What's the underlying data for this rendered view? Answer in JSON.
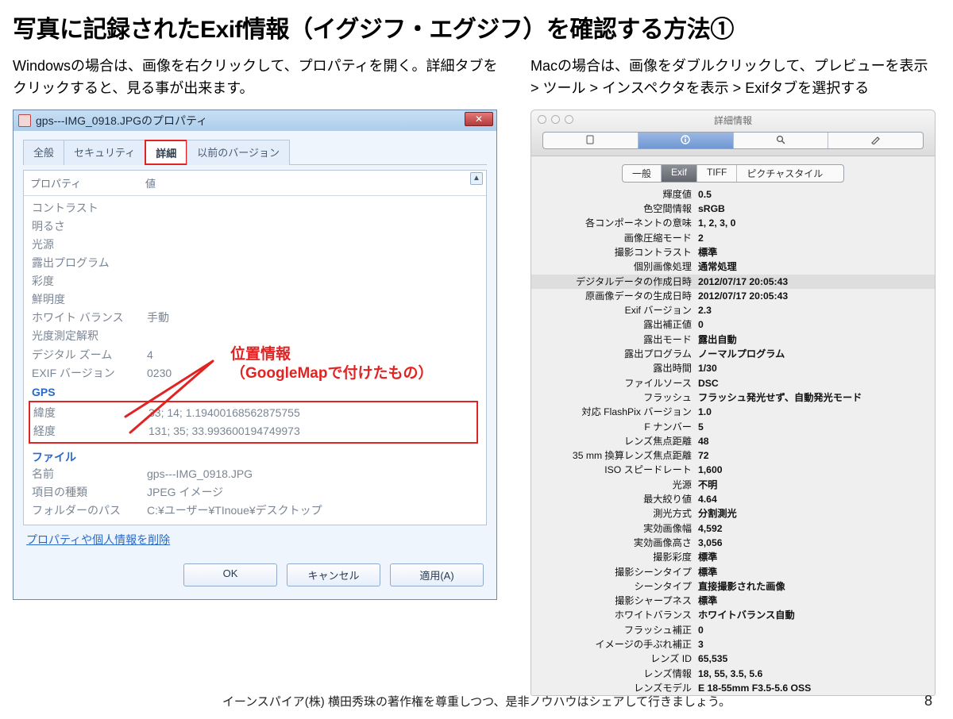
{
  "title": "写真に記録されたExif情報（イグジフ・エグジフ）を確認する方法①",
  "left": {
    "lead": "Windowsの場合は、画像を右クリックして、プロパティを開く。詳細タブをクリックすると、見る事が出来ます。",
    "win": {
      "title": "gps---IMG_0918.JPGのプロパティ",
      "tabs": {
        "t0": "全般",
        "t1": "セキュリティ",
        "t2": "詳細",
        "t3": "以前のバージョン"
      },
      "header": {
        "c1": "プロパティ",
        "c2": "値"
      },
      "rows": {
        "r0k": "コントラスト",
        "r0v": "",
        "r1k": "明るさ",
        "r1v": "",
        "r2k": "光源",
        "r2v": "",
        "r3k": "露出プログラム",
        "r3v": "",
        "r4k": "彩度",
        "r4v": "",
        "r5k": "鮮明度",
        "r5v": "",
        "r6k": "ホワイト バランス",
        "r6v": "手動",
        "r7k": "光度測定解釈",
        "r7v": "",
        "r8k": "デジタル ズーム",
        "r8v": "4",
        "r9k": "EXIF バージョン",
        "r9v": "0230"
      },
      "gps": {
        "head": "GPS",
        "latk": "緯度",
        "latv": "33; 14; 1.19400168562875755",
        "lonk": "経度",
        "lonv": "131; 35; 33.993600194749973"
      },
      "file": {
        "head": "ファイル",
        "namek": "名前",
        "namev": "gps---IMG_0918.JPG",
        "typek": "項目の種類",
        "typev": "JPEG イメージ",
        "pathk": "フォルダーのパス",
        "pathv": "C:¥ユーザー¥TInoue¥デスクトップ"
      },
      "link": "プロパティや個人情報を削除",
      "buttons": {
        "ok": "OK",
        "cancel": "キャンセル",
        "apply": "適用(A)"
      },
      "annotation": {
        "l1": "位置情報",
        "l2": "（GoogleMapで付けたもの）"
      }
    }
  },
  "right": {
    "lead": "Macの場合は、画像をダブルクリックして、プレビューを表示 > ツール > インスペクタを表示 > Exifタブを選択する",
    "mac": {
      "title": "詳細情報",
      "tabs": {
        "t0": "一般",
        "t1": "Exif",
        "t2": "TIFF",
        "t3": "ピクチャスタイル"
      },
      "rows": [
        {
          "k": "輝度値",
          "v": "0.5"
        },
        {
          "k": "色空間情報",
          "v": "sRGB"
        },
        {
          "k": "各コンポーネントの意味",
          "v": "1, 2, 3, 0"
        },
        {
          "k": "画像圧縮モード",
          "v": "2"
        },
        {
          "k": "撮影コントラスト",
          "v": "標準"
        },
        {
          "k": "個別画像処理",
          "v": "通常処理"
        },
        {
          "k": "デジタルデータの作成日時",
          "v": "2012/07/17 20:05:43",
          "hl": true
        },
        {
          "k": "原画像データの生成日時",
          "v": "2012/07/17 20:05:43"
        },
        {
          "k": "Exif バージョン",
          "v": "2.3"
        },
        {
          "k": "露出補正値",
          "v": "0"
        },
        {
          "k": "露出モード",
          "v": "露出自動"
        },
        {
          "k": "露出プログラム",
          "v": "ノーマルプログラム"
        },
        {
          "k": "露出時間",
          "v": "1/30"
        },
        {
          "k": "ファイルソース",
          "v": "DSC"
        },
        {
          "k": "フラッシュ",
          "v": "フラッシュ発光せず、自動発光モード"
        },
        {
          "k": "対応 FlashPix バージョン",
          "v": "1.0"
        },
        {
          "k": "F ナンバー",
          "v": "5"
        },
        {
          "k": "レンズ焦点距離",
          "v": "48"
        },
        {
          "k": "35 mm 換算レンズ焦点距離",
          "v": "72"
        },
        {
          "k": "ISO スピードレート",
          "v": "1,600"
        },
        {
          "k": "光源",
          "v": "不明"
        },
        {
          "k": "最大絞り値",
          "v": "4.64"
        },
        {
          "k": "測光方式",
          "v": "分割測光"
        },
        {
          "k": "実効画像幅",
          "v": "4,592"
        },
        {
          "k": "実効画像高さ",
          "v": "3,056"
        },
        {
          "k": "撮影彩度",
          "v": "標準"
        },
        {
          "k": "撮影シーンタイプ",
          "v": "標準"
        },
        {
          "k": "シーンタイプ",
          "v": "直接撮影された画像"
        },
        {
          "k": "撮影シャープネス",
          "v": "標準"
        },
        {
          "k": "ホワイトバランス",
          "v": "ホワイトバランス自動"
        },
        {
          "k": "フラッシュ補正",
          "v": "0"
        },
        {
          "k": "イメージの手ぶれ補正",
          "v": "3"
        },
        {
          "k": "レンズ ID",
          "v": "65,535"
        },
        {
          "k": "レンズ情報",
          "v": "18, 55, 3.5, 5.6"
        },
        {
          "k": "レンズモデル",
          "v": "E 18-55mm F3.5-5.6 OSS"
        }
      ]
    }
  },
  "footer": "イーンスパイア(株) 横田秀珠の著作権を尊重しつつ、是非ノウハウはシェアして行きましょう。",
  "page": "8"
}
